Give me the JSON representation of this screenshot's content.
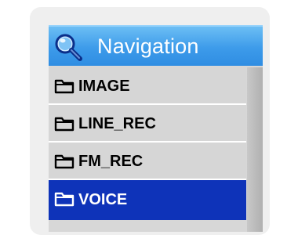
{
  "title": "Navigation",
  "title_icon": "magnifier-icon",
  "items": [
    {
      "label": "IMAGE",
      "icon": "folder-icon",
      "selected": false
    },
    {
      "label": "LINE_REC",
      "icon": "folder-icon",
      "selected": false
    },
    {
      "label": "FM_REC",
      "icon": "folder-icon",
      "selected": false
    },
    {
      "label": "VOICE",
      "icon": "folder-icon",
      "selected": true
    }
  ],
  "colors": {
    "title_bar": "#3d9bea",
    "selected_row": "#0e33b9",
    "row_background": "#d6d6d6",
    "scrollbar_thumb": "#bcbcbc"
  }
}
